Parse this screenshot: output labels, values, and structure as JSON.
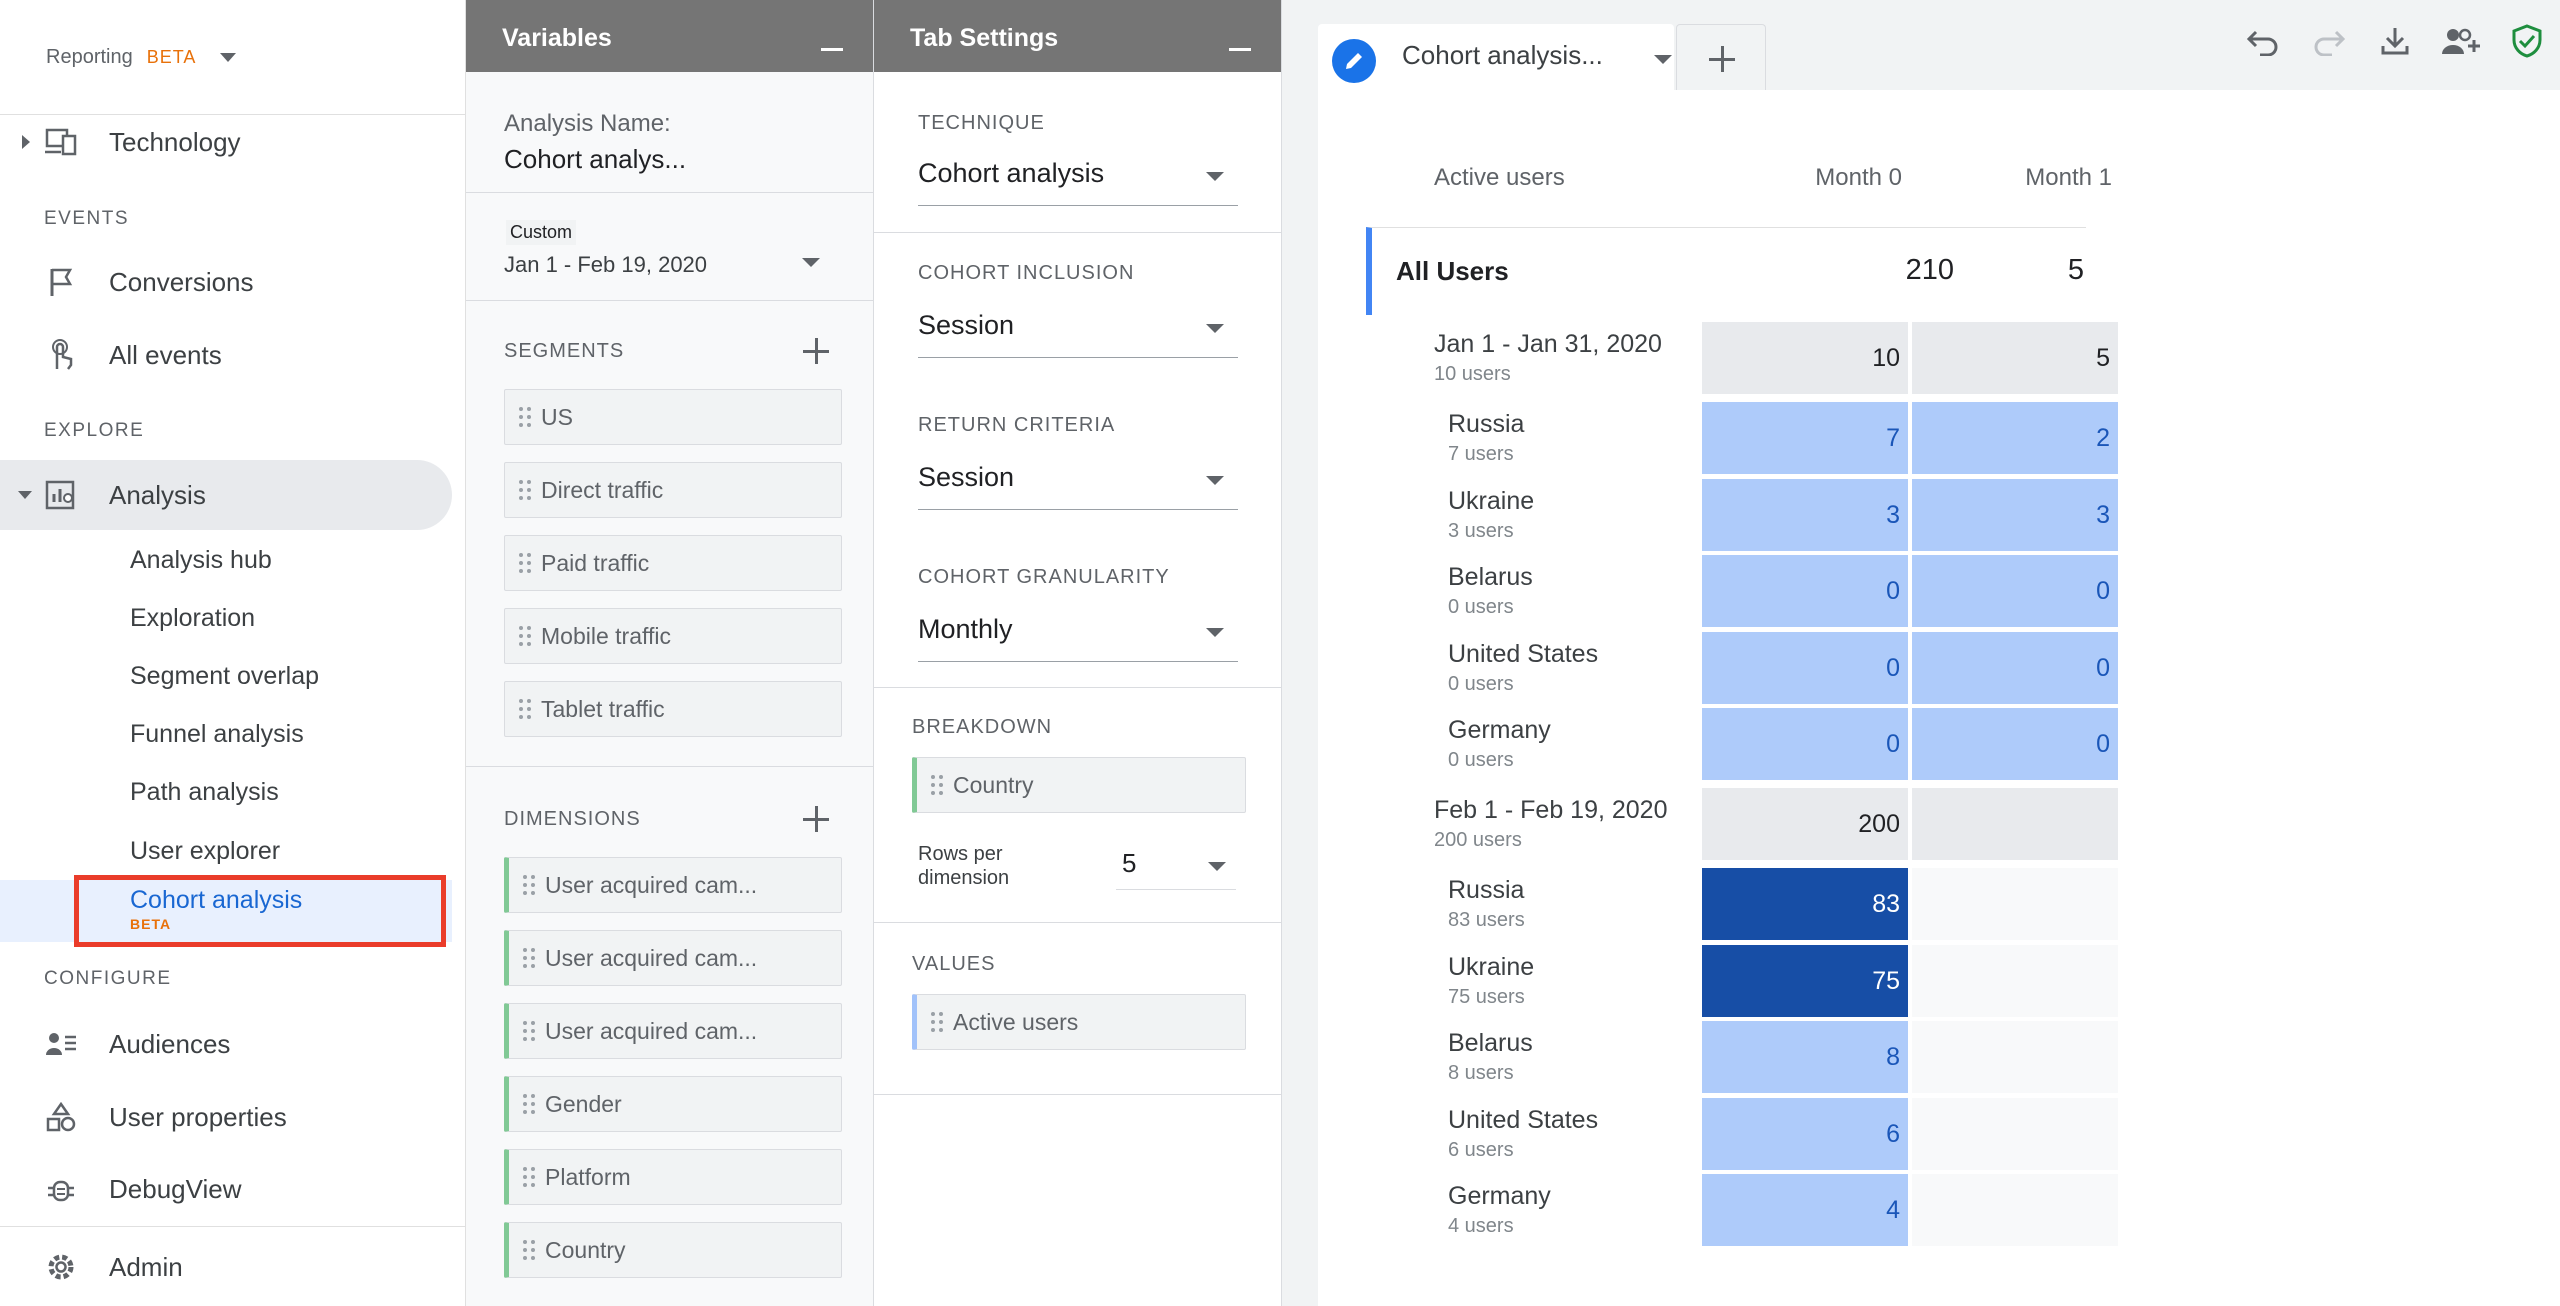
{
  "nav": {
    "reporting_label": "Reporting",
    "reporting_badge": "BETA",
    "technology": "Technology",
    "events_section": "EVENTS",
    "conversions": "Conversions",
    "all_events": "All events",
    "explore_section": "EXPLORE",
    "analysis": "Analysis",
    "sub_items": [
      "Analysis hub",
      "Exploration",
      "Segment overlap",
      "Funnel analysis",
      "Path analysis",
      "User explorer"
    ],
    "cohort": "Cohort analysis",
    "cohort_badge": "BETA",
    "configure_section": "CONFIGURE",
    "audiences": "Audiences",
    "user_properties": "User properties",
    "debugview": "DebugView",
    "admin": "Admin"
  },
  "variables": {
    "title": "Variables",
    "analysis_name_label": "Analysis Name:",
    "analysis_name_value": "Cohort analys...",
    "date_badge": "Custom",
    "date_range": "Jan 1 - Feb 19, 2020",
    "segments_title": "SEGMENTS",
    "segments": [
      "US",
      "Direct traffic",
      "Paid traffic",
      "Mobile traffic",
      "Tablet traffic"
    ],
    "dimensions_title": "DIMENSIONS",
    "dimensions": [
      "User acquired cam...",
      "User acquired cam...",
      "User acquired cam...",
      "Gender",
      "Platform",
      "Country"
    ]
  },
  "tab_settings": {
    "title": "Tab Settings",
    "technique_label": "TECHNIQUE",
    "technique_value": "Cohort analysis",
    "inclusion_label": "COHORT INCLUSION",
    "inclusion_value": "Session",
    "return_label": "RETURN CRITERIA",
    "return_value": "Session",
    "granularity_label": "COHORT GRANULARITY",
    "granularity_value": "Monthly",
    "breakdown_label": "BREAKDOWN",
    "breakdown_value": "Country",
    "rows_label": "Rows per dimension",
    "rows_value": "5",
    "values_label": "VALUES",
    "values_value": "Active users"
  },
  "main": {
    "tab_label": "Cohort analysis...",
    "icons": [
      "undo-icon",
      "redo-icon",
      "download-icon",
      "share-users-icon",
      "shield-check-icon"
    ],
    "colors": {
      "light_cell": "#aecbfa",
      "dark_cell": "#174ea6",
      "accent": "#1a73e8"
    },
    "table": {
      "metric_header": "Active users",
      "columns": [
        "Month 0",
        "Month 1"
      ],
      "all_users": {
        "label": "All Users",
        "values": [
          "210",
          "5"
        ]
      },
      "cohorts": [
        {
          "label": "Jan 1 - Jan 31, 2020",
          "users": "10 users",
          "values": [
            "10",
            "5"
          ],
          "rows": [
            {
              "label": "Russia",
              "users": "7 users",
              "values": [
                "7",
                "2"
              ]
            },
            {
              "label": "Ukraine",
              "users": "3 users",
              "values": [
                "3",
                "3"
              ]
            },
            {
              "label": "Belarus",
              "users": "0 users",
              "values": [
                "0",
                "0"
              ]
            },
            {
              "label": "United States",
              "users": "0 users",
              "values": [
                "0",
                "0"
              ]
            },
            {
              "label": "Germany",
              "users": "0 users",
              "values": [
                "0",
                "0"
              ]
            }
          ]
        },
        {
          "label": "Feb 1 - Feb 19, 2020",
          "users": "200 users",
          "values": [
            "200",
            ""
          ],
          "rows": [
            {
              "label": "Russia",
              "users": "83 users",
              "values": [
                "83",
                ""
              ]
            },
            {
              "label": "Ukraine",
              "users": "75 users",
              "values": [
                "75",
                ""
              ]
            },
            {
              "label": "Belarus",
              "users": "8 users",
              "values": [
                "8",
                ""
              ]
            },
            {
              "label": "United States",
              "users": "6 users",
              "values": [
                "6",
                ""
              ]
            },
            {
              "label": "Germany",
              "users": "4 users",
              "values": [
                "4",
                ""
              ]
            }
          ]
        }
      ]
    }
  }
}
